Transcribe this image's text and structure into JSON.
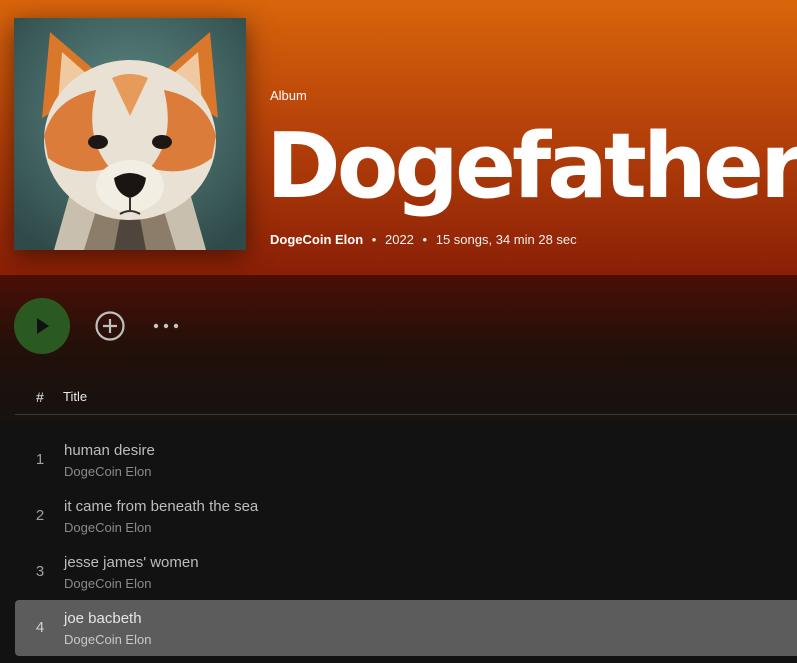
{
  "album": {
    "type_label": "Album",
    "title": "Dogefather",
    "artist": "DogeCoin Elon",
    "year": "2022",
    "song_count": "15 songs,",
    "duration": "34 min 28 sec",
    "separator": "•",
    "cover_icon": "shiba-dog-artwork"
  },
  "actions": {
    "play_icon": "play-icon",
    "add_icon": "plus-circle-icon",
    "more_icon": "more-dots-icon"
  },
  "table": {
    "num_header": "#",
    "title_header": "Title"
  },
  "tracks": [
    {
      "num": "1",
      "title": "human desire",
      "artist": "DogeCoin Elon"
    },
    {
      "num": "2",
      "title": "it came from beneath the sea",
      "artist": "DogeCoin Elon"
    },
    {
      "num": "3",
      "title": "jesse james' women",
      "artist": "DogeCoin Elon"
    },
    {
      "num": "4",
      "title": "joe bacbeth",
      "artist": "DogeCoin Elon",
      "highlighted": true
    }
  ],
  "colors": {
    "header_top": "#d9650b",
    "header_bottom": "#8a1f06",
    "play_button": "#2a5a22",
    "background": "#121212",
    "row_highlight": "#5c5c5c"
  }
}
